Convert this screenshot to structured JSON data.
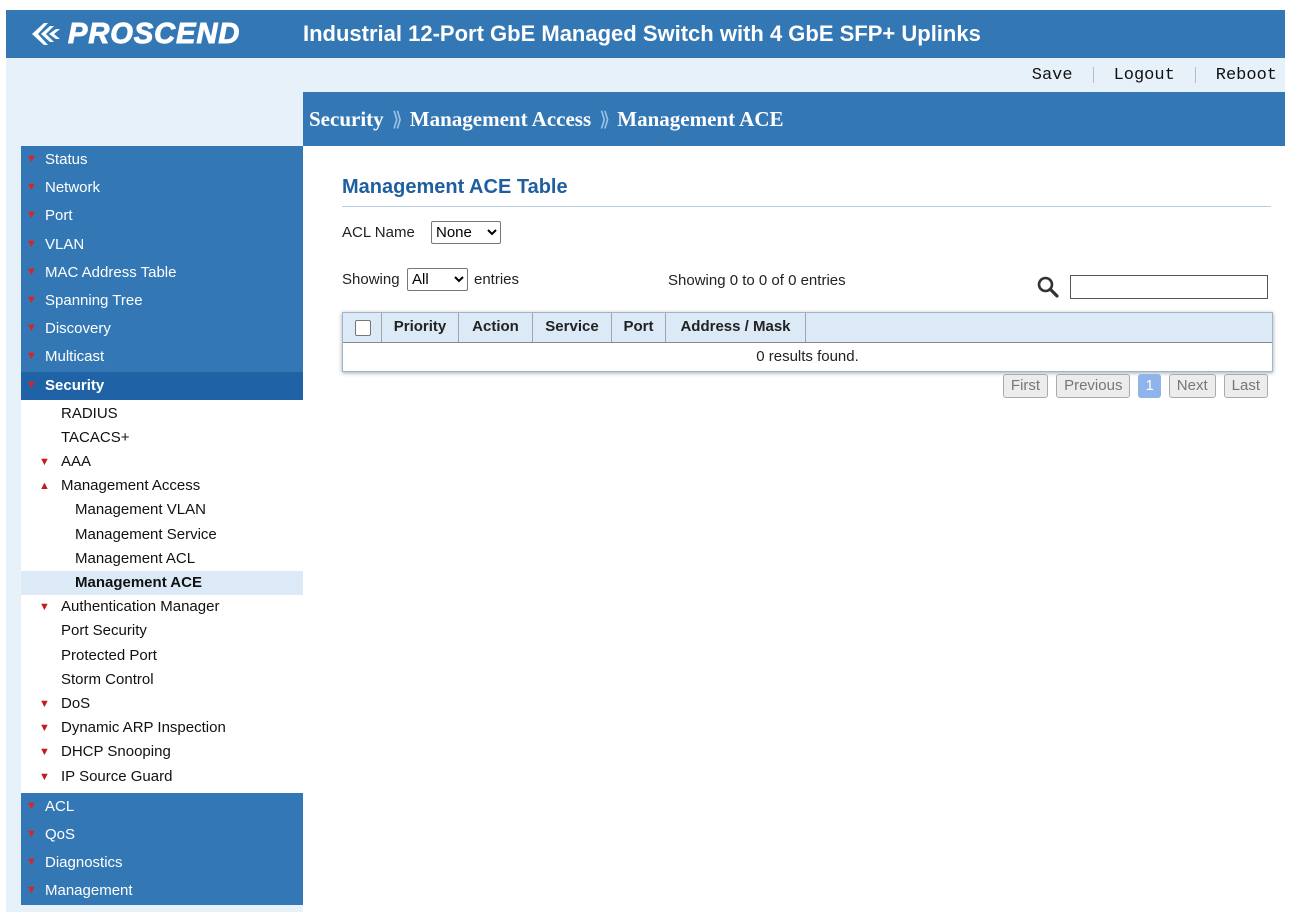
{
  "brand": {
    "logo_text": "PROSCEND"
  },
  "header": {
    "title": "Industrial 12-Port GbE Managed Switch with 4 GbE SFP+ Uplinks"
  },
  "top_links": {
    "save": "Save",
    "logout": "Logout",
    "reboot": "Reboot"
  },
  "breadcrumb": {
    "level1": "Security",
    "level2": "Management Access",
    "level3": "Management ACE",
    "separator": "⟫"
  },
  "sidebar": {
    "top_before": [
      {
        "label": "Status"
      },
      {
        "label": "Network"
      },
      {
        "label": "Port"
      },
      {
        "label": "VLAN"
      },
      {
        "label": "MAC Address Table"
      },
      {
        "label": "Spanning Tree"
      },
      {
        "label": "Discovery"
      },
      {
        "label": "Multicast"
      }
    ],
    "active": {
      "label": "Security"
    },
    "security_items": [
      {
        "label": "RADIUS"
      },
      {
        "label": "TACACS+"
      },
      {
        "label": "AAA"
      },
      {
        "label": "Management Access"
      },
      {
        "label": "Management VLAN"
      },
      {
        "label": "Management Service"
      },
      {
        "label": "Management ACL"
      },
      {
        "label": "Management ACE"
      },
      {
        "label": "Authentication Manager"
      },
      {
        "label": "Port Security"
      },
      {
        "label": "Protected Port"
      },
      {
        "label": "Storm Control"
      },
      {
        "label": "DoS"
      },
      {
        "label": "Dynamic ARP Inspection"
      },
      {
        "label": "DHCP Snooping"
      },
      {
        "label": "IP Source Guard"
      }
    ],
    "top_after": [
      {
        "label": "ACL"
      },
      {
        "label": "QoS"
      },
      {
        "label": "Diagnostics"
      },
      {
        "label": "Management"
      }
    ]
  },
  "main": {
    "title": "Management ACE Table",
    "acl_name_label": "ACL Name",
    "acl_name_value": "None",
    "showing_label": "Showing",
    "entries_value": "All",
    "entries_label": "entries",
    "info": "Showing 0 to 0 of 0 entries",
    "columns": [
      "Priority",
      "Action",
      "Service",
      "Port",
      "Address / Mask"
    ],
    "empty_message": "0 results found.",
    "pager": {
      "first": "First",
      "previous": "Previous",
      "current": "1",
      "next": "Next",
      "last": "Last"
    }
  },
  "colors": {
    "brand_blue": "#3378b5",
    "active_nav": "#1f63a6",
    "title_blue": "#1f5f9f",
    "caret_red": "#c21b1b"
  },
  "icons": {
    "logo": "proscend-logo-icon",
    "search": "search-icon",
    "expand": "chevron-down-icon",
    "collapse": "chevron-up-icon"
  }
}
